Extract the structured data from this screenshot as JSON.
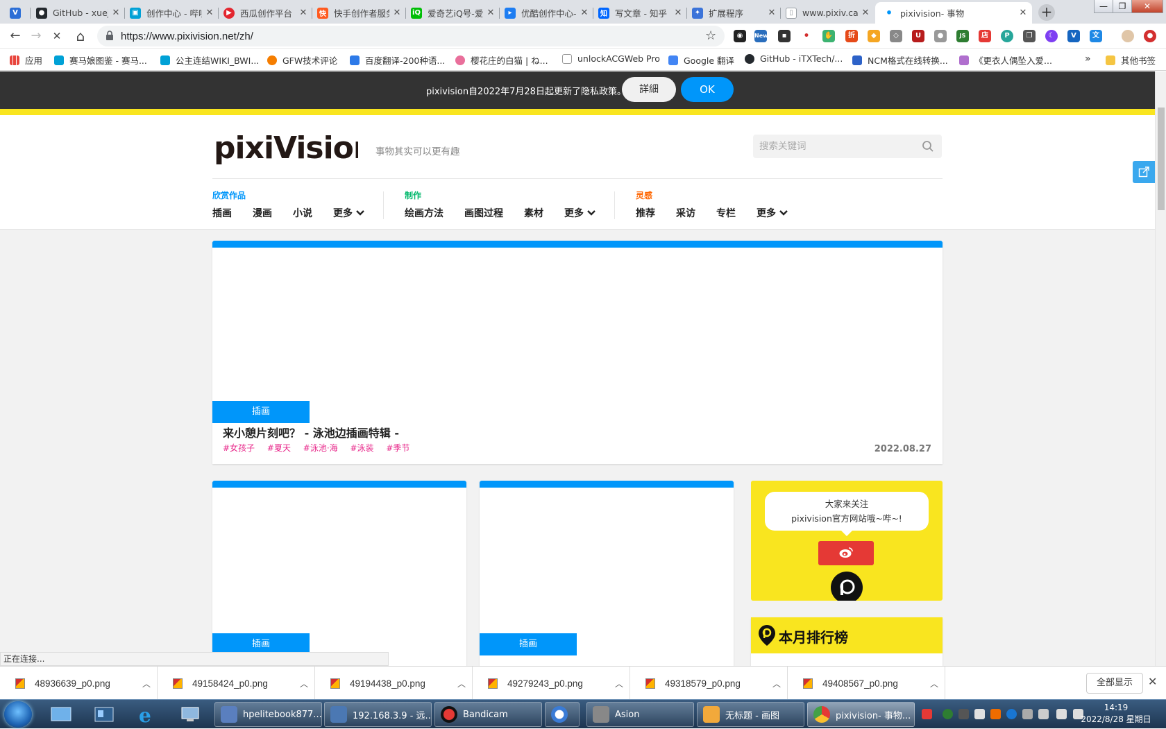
{
  "tabs": [
    {
      "title": "",
      "favicon_color": "#2c6ed6",
      "favicon_glyph": "V",
      "closable": false
    },
    {
      "title": "GitHub - xuej",
      "favicon_color": "#24292e",
      "favicon_glyph": "●"
    },
    {
      "title": "创作中心 - 哔哩",
      "favicon_color": "#00a1d6",
      "favicon_glyph": "▣"
    },
    {
      "title": "西瓜创作平台",
      "favicon_color": "#e3262f",
      "favicon_glyph": "▶"
    },
    {
      "title": "快手创作者服务",
      "favicon_color": "#ff5a1f",
      "favicon_glyph": "快"
    },
    {
      "title": "爱奇艺iQ号-爱",
      "favicon_color": "#00be06",
      "favicon_glyph": "iQ"
    },
    {
      "title": "优酷创作中心-",
      "favicon_color": "#1d7df2",
      "favicon_glyph": "▸"
    },
    {
      "title": "写文章 - 知乎",
      "favicon_color": "#0066ff",
      "favicon_glyph": "知"
    },
    {
      "title": "扩展程序",
      "favicon_color": "#3b73d9",
      "favicon_glyph": "✦"
    },
    {
      "title": "www.pixiv.cat",
      "favicon_color": "#9aa0a6",
      "favicon_glyph": "▯"
    },
    {
      "title": "pixivision- 事物",
      "favicon_color": "#0096fa",
      "favicon_glyph": "•",
      "active": true
    }
  ],
  "window_controls": {
    "minimize": "—",
    "maximize": "❐",
    "close": "✕"
  },
  "toolbar": {
    "url": "https://www.pixivision.net/zh/",
    "back": "←",
    "forward": "→",
    "stop": "✕",
    "home": "⌂",
    "lock": "🔒",
    "star": "☆"
  },
  "bookmarks": [
    {
      "label": "应用",
      "color": "#e8453c"
    },
    {
      "label": "赛马娘图鉴 - 赛马...",
      "color": "#00a1d6"
    },
    {
      "label": "公主连结WIKI_BWI...",
      "color": "#00a1d6"
    },
    {
      "label": "GFW技术评论",
      "color": "#f57d00"
    },
    {
      "label": "百度翻译-200种语...",
      "color": "#2d7ae8"
    },
    {
      "label": "樱花庄的白猫 | ね...",
      "color": "#e96f9b"
    },
    {
      "label": "unlockACGWeb Pro",
      "color": "#cfcfcf"
    },
    {
      "label": "Google 翻译",
      "color": "#4285f4"
    },
    {
      "label": "GitHub - iTXTech/...",
      "color": "#24292e"
    },
    {
      "label": "NCM格式在线转换...",
      "color": "#2d62c8"
    },
    {
      "label": "《更衣人偶坠入爱...",
      "color": "#b06fce"
    }
  ],
  "bookmarks_overflow": "»",
  "bookmarks_other": "其他书签",
  "notice": {
    "text": "pixivision自2022年7月28日起更新了隐私政策。",
    "detail_label": "詳細",
    "ok_label": "OK"
  },
  "site": {
    "logo_text": "pixiVision",
    "tagline": "事物其实可以更有趣",
    "search_placeholder": "搜索关键词",
    "nav": [
      {
        "category": "欣赏作品",
        "color": "#0096fa",
        "items": [
          "插画",
          "漫画",
          "小说",
          "更多"
        ]
      },
      {
        "category": "制作",
        "color": "#00b86b",
        "items": [
          "绘画方法",
          "画图过程",
          "素材",
          "更多"
        ]
      },
      {
        "category": "灵感",
        "color": "#ff6600",
        "items": [
          "推荐",
          "采访",
          "专栏",
          "更多"
        ]
      }
    ]
  },
  "feature": {
    "category": "插画",
    "title": "来小憩片刻吧？ - 泳池边插画特辑 -",
    "tags": [
      "#女孩子",
      "#夏天",
      "#泳池·海",
      "#泳装",
      "#季节"
    ],
    "date": "2022.08.27"
  },
  "cards": [
    {
      "category": "插画"
    },
    {
      "category": "插画"
    }
  ],
  "social": {
    "line1": "大家来关注",
    "line2": "pixivision官方网站哦~哔~!"
  },
  "ranking": {
    "title": "本月排行榜"
  },
  "status_text": "正在连接...",
  "downloads": [
    {
      "name": "48936639_p0.png"
    },
    {
      "name": "49158424_p0.png"
    },
    {
      "name": "49194438_p0.png"
    },
    {
      "name": "49279243_p0.png"
    },
    {
      "name": "49318579_p0.png"
    },
    {
      "name": "49408567_p0.png"
    }
  ],
  "downloads_show_all": "全部显示",
  "downloads_close": "✕",
  "taskbar": [
    {
      "label": "hpelitebook877...",
      "color": "#5a7fbf"
    },
    {
      "label": "192.168.3.9 - 远...",
      "color": "#4b78b3"
    },
    {
      "label": "Bandicam",
      "color": "#1a1a1a"
    },
    {
      "label": "",
      "color": "#3a7bd5"
    },
    {
      "label": "Asion",
      "color": "#888888"
    },
    {
      "label": "无标题 - 画图",
      "color": "#f2a93b"
    },
    {
      "label": "pixivision- 事物...",
      "color": "#4caf50"
    }
  ],
  "clock": {
    "time": "14:19",
    "date": "2022/8/28 星期日"
  },
  "colors": {
    "accent": "#0096fa",
    "yellow": "#f9e51f",
    "tag": "#e8298b"
  }
}
